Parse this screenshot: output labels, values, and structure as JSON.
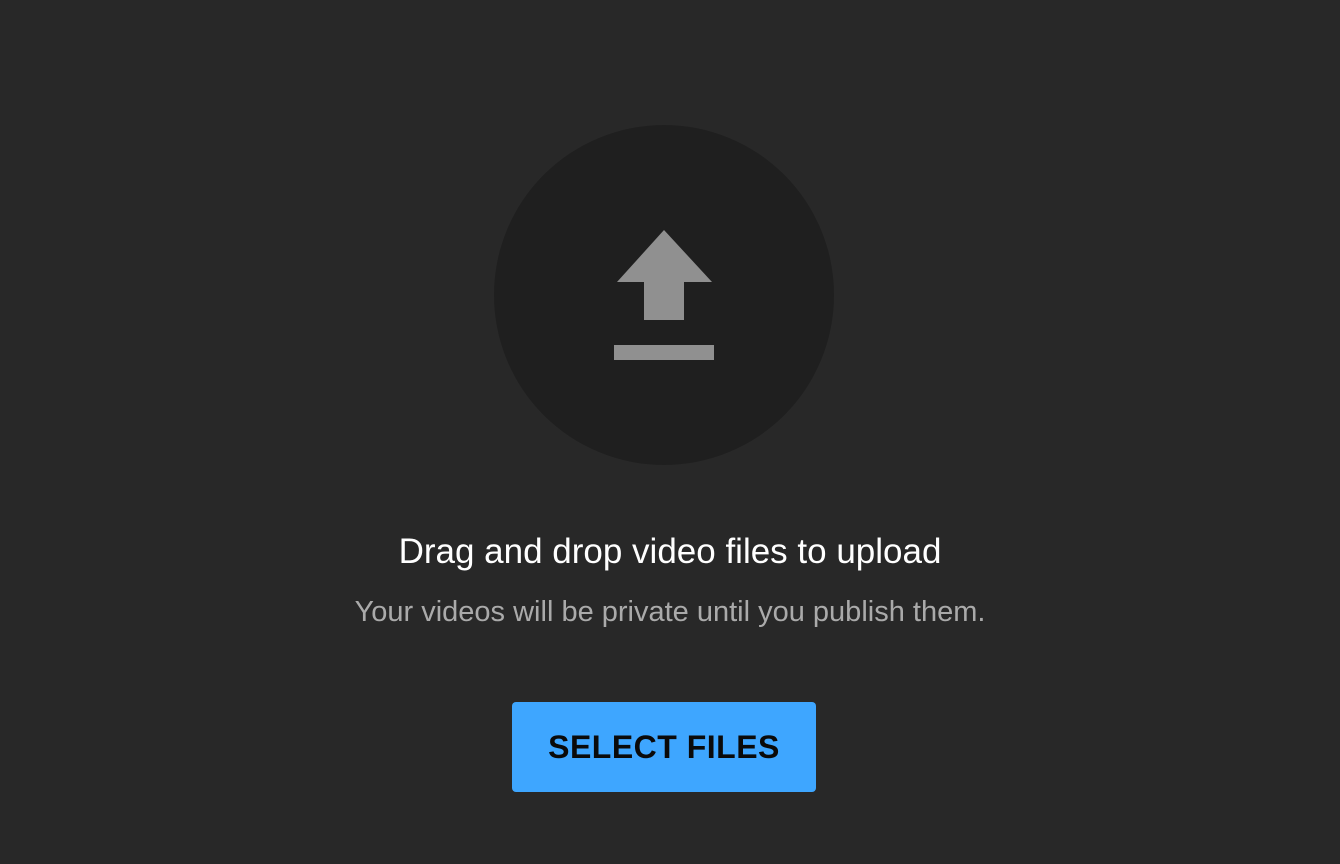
{
  "upload": {
    "headline": "Drag and drop video files to upload",
    "subtext": "Your videos will be private until you publish them.",
    "select_button_label": "SELECT FILES",
    "icon": "upload-icon"
  },
  "colors": {
    "background": "#282828",
    "circle": "#1f1f1f",
    "icon": "#909090",
    "headline_text": "#ffffff",
    "subtext": "#aaaaaa",
    "button_bg": "#3ea6ff",
    "button_text": "#0a0a0a"
  }
}
